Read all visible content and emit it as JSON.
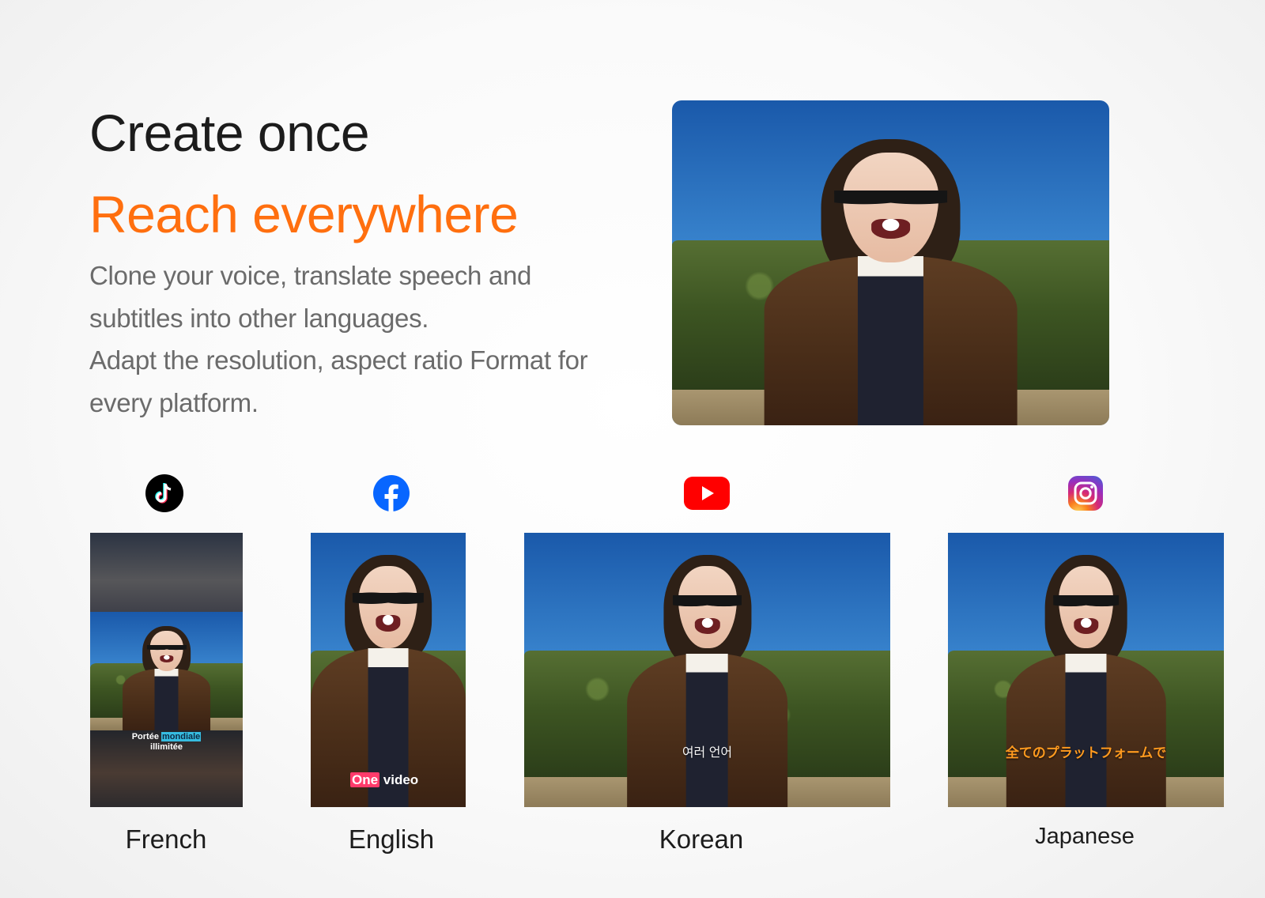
{
  "hero": {
    "title_line1": "Create once",
    "title_line2": "Reach everywhere",
    "description": [
      "Clone your voice, translate speech and subtitles into other languages.",
      "Adapt the resolution, aspect ratio Format for every platform."
    ]
  },
  "colors": {
    "accent": "#ff6f0f",
    "headline": "#1c1c1c",
    "body_text": "#6b6b6b"
  },
  "platforms": [
    {
      "name": "TikTok",
      "icon": "tiktok-icon",
      "language": "French",
      "subtitle": {
        "pre": "Portée ",
        "highlight": "mondiale",
        "line2": "illimitée"
      }
    },
    {
      "name": "Facebook",
      "icon": "facebook-icon",
      "language": "English",
      "subtitle": {
        "highlight": "One",
        "post": " video"
      }
    },
    {
      "name": "YouTube",
      "icon": "youtube-icon",
      "language": "Korean",
      "subtitle": {
        "text": "여러 언어"
      }
    },
    {
      "name": "Instagram",
      "icon": "instagram-icon",
      "language": "Japanese",
      "subtitle": {
        "text": "全てのプラットフォームで"
      }
    }
  ]
}
